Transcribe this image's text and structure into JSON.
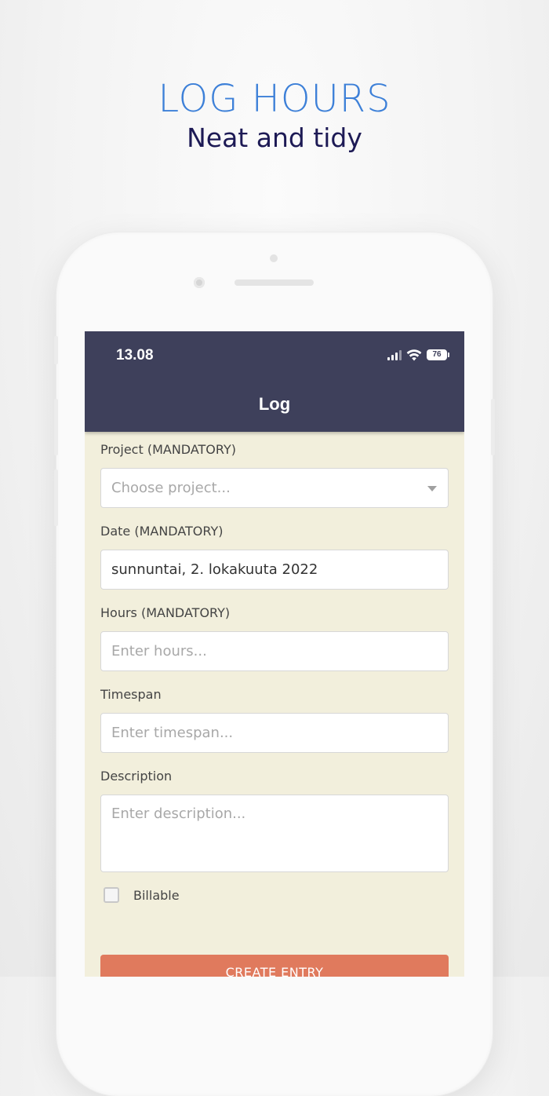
{
  "promo": {
    "headline": "LOG HOURS",
    "subline": "Neat and tidy"
  },
  "status_bar": {
    "time": "13.08",
    "battery": "76",
    "icons": [
      "signal-icon",
      "wifi-icon",
      "battery-icon"
    ]
  },
  "app_bar": {
    "title": "Log"
  },
  "form": {
    "project": {
      "label": "Project (MANDATORY)",
      "placeholder": "Choose project..."
    },
    "date": {
      "label": "Date (MANDATORY)",
      "value": "sunnuntai, 2. lokakuuta 2022"
    },
    "hours": {
      "label": "Hours (MANDATORY)",
      "placeholder": "Enter hours..."
    },
    "timespan": {
      "label": "Timespan",
      "placeholder": "Enter timespan..."
    },
    "description": {
      "label": "Description",
      "placeholder": "Enter description..."
    },
    "billable": {
      "label": "Billable",
      "checked": false
    },
    "submit_label": "CREATE ENTRY"
  },
  "colors": {
    "headline": "#3d80d8",
    "subline": "#1d1a55",
    "app_bar": "#3e405b",
    "screen_bg": "#f2efdc",
    "button": "#e07a5d"
  }
}
